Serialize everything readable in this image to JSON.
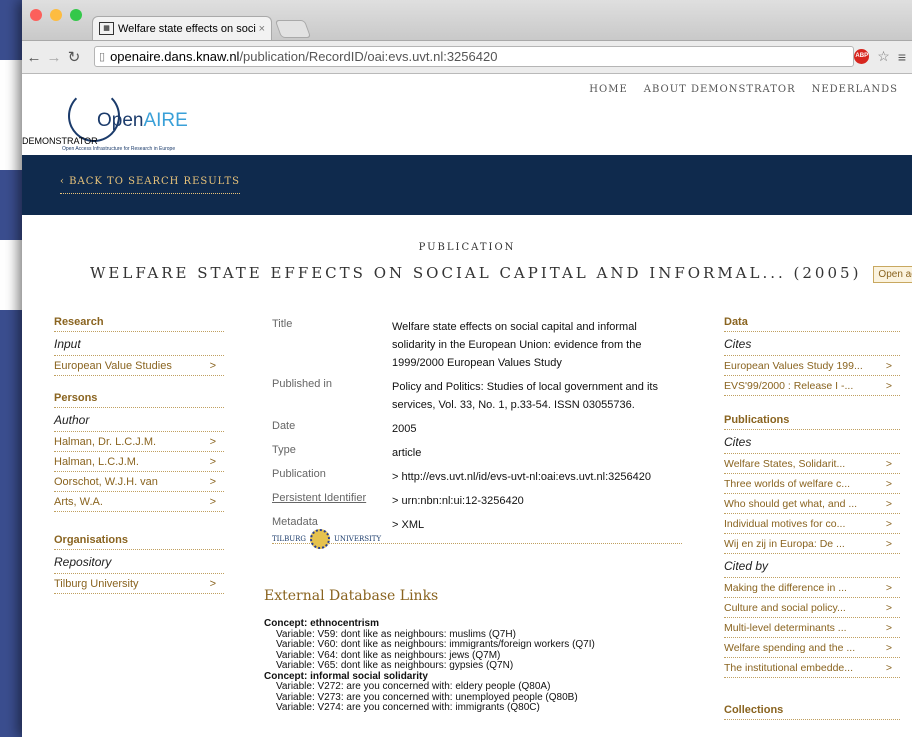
{
  "browser": {
    "tab_title": "Welfare state effects on soci",
    "tab_close": "×",
    "url_host": "openaire.dans.knaw.nl",
    "url_path": "/publication/RecordID/oai:evs.uvt.nl:3256420",
    "colors": {
      "close": "#fc605b",
      "minimize": "#fdbc40",
      "zoom": "#34c84a"
    }
  },
  "nav": {
    "home": "HOME",
    "about": "ABOUT DEMONSTRATOR",
    "lang": "NEDERLANDS"
  },
  "logo": {
    "name_a": "Open",
    "name_b": "AIRE",
    "demo": "DEMONSTRATOR",
    "tagline": "Open Access Infrastructure for Research in Europe"
  },
  "back": "‹  BACK TO SEARCH RESULTS",
  "publication": {
    "kicker": "PUBLICATION",
    "title": "WELFARE STATE EFFECTS ON SOCIAL CAPITAL AND INFORMAL... (2005)",
    "access": "Open access"
  },
  "left": {
    "research": "Research",
    "input": "Input",
    "input_items": [
      "European Value Studies"
    ],
    "persons": "Persons",
    "author": "Author",
    "authors": [
      "Halman, Dr. L.C.J.M.",
      "Halman, L.C.J.M.",
      "Oorschot, W.J.H. van",
      "Arts, W.A."
    ],
    "organisations": "Organisations",
    "repository": "Repository",
    "repos": [
      "Tilburg University"
    ],
    "chev": ">"
  },
  "meta": {
    "title_l": "Title",
    "title_v": "Welfare state effects on social capital and informal solidarity in the European Union: evidence from the 1999/2000 European Values Study",
    "pub_l": "Published in",
    "pub_v": "Policy and Politics: Studies of local government and its services, Vol. 33, No. 1, p.33-54. ISSN 03055736.",
    "date_l": "Date",
    "date_v": "2005",
    "type_l": "Type",
    "type_v": "article",
    "publ_l": "Publication",
    "publ_v": "> http://evs.uvt.nl/id/evs-uvt-nl:oai:evs.uvt.nl:3256420",
    "pid_l": "Persistent Identifier",
    "pid_v": "> urn:nbn:nl:ui:12-3256420",
    "md_l": "Metadata",
    "md_v": "> XML"
  },
  "tilburg": {
    "a": "TILBURG",
    "b": "UNIVERSITY"
  },
  "external": {
    "heading": "External Database Links",
    "lines": [
      {
        "c": "Concept: ethnocentrism"
      },
      {
        "v": "Variable: V59: dont like as neighbours: muslims (Q7H)"
      },
      {
        "v": "Variable: V60: dont like as neighbours: immigrants/foreign workers (Q7I)"
      },
      {
        "v": "Variable: V64: dont like as neighbours: jews (Q7M)"
      },
      {
        "v": "Variable: V65: dont like as neighbours: gypsies (Q7N)"
      },
      {
        "c": "Concept: informal social solidarity"
      },
      {
        "v": "Variable: V272: are you concerned with: eldery people (Q80A)"
      },
      {
        "v": "Variable: V273: are you concerned with: unemployed people (Q80B)"
      },
      {
        "v": "Variable: V274: are you concerned with: immigrants (Q80C)"
      }
    ]
  },
  "right": {
    "data": "Data",
    "cites": "Cites",
    "data_items": [
      "European Values Study 199...",
      "EVS'99/2000 : Release I -..."
    ],
    "publications": "Publications",
    "pub_cites": "Cites",
    "pub_items": [
      "Welfare States, Solidarit...",
      "Three worlds of welfare c...",
      "Who should get what, and ...",
      "Individual motives for co...",
      "Wij en zij in Europa: De ..."
    ],
    "cited_by": "Cited by",
    "cited_items": [
      "Making the difference in ...",
      "Culture and social policy...",
      "Multi-level determinants ...",
      "Welfare spending and the ...",
      "The institutional embedde..."
    ],
    "collections": "Collections",
    "chev": ">"
  }
}
